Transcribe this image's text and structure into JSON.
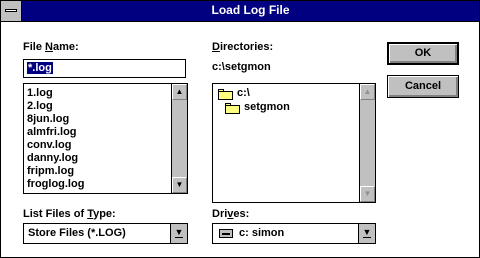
{
  "window": {
    "title": "Load Log File"
  },
  "file_name": {
    "label_pre": "File ",
    "label_hot": "N",
    "label_post": "ame:",
    "value": "*.log"
  },
  "files": {
    "items": [
      "1.log",
      "2.log",
      "8jun.log",
      "almfri.log",
      "conv.log",
      "danny.log",
      "fripm.log",
      "froglog.log"
    ]
  },
  "directories": {
    "label_hot": "D",
    "label_post": "irectories:",
    "current_path": "c:\\setgmon",
    "items": [
      "c:\\",
      "setgmon"
    ]
  },
  "file_type": {
    "label_pre": "List Files of ",
    "label_hot": "T",
    "label_post": "ype:",
    "value": "Store Files (*.LOG)"
  },
  "drives": {
    "label_pre": "Dri",
    "label_hot": "v",
    "label_post": "es:",
    "value": "c: simon"
  },
  "buttons": {
    "ok": "OK",
    "cancel": "Cancel"
  },
  "icons": {
    "system_menu": "system-menu-icon",
    "scroll_up": "up-arrow-icon",
    "scroll_down": "down-arrow-icon",
    "folder": "folder-icon",
    "drive": "hard-drive-icon",
    "dropdown": "dropdown-arrow-icon"
  },
  "colors": {
    "title_bar": "#000080",
    "selection": "#000080",
    "face": "#c0c0c0"
  }
}
